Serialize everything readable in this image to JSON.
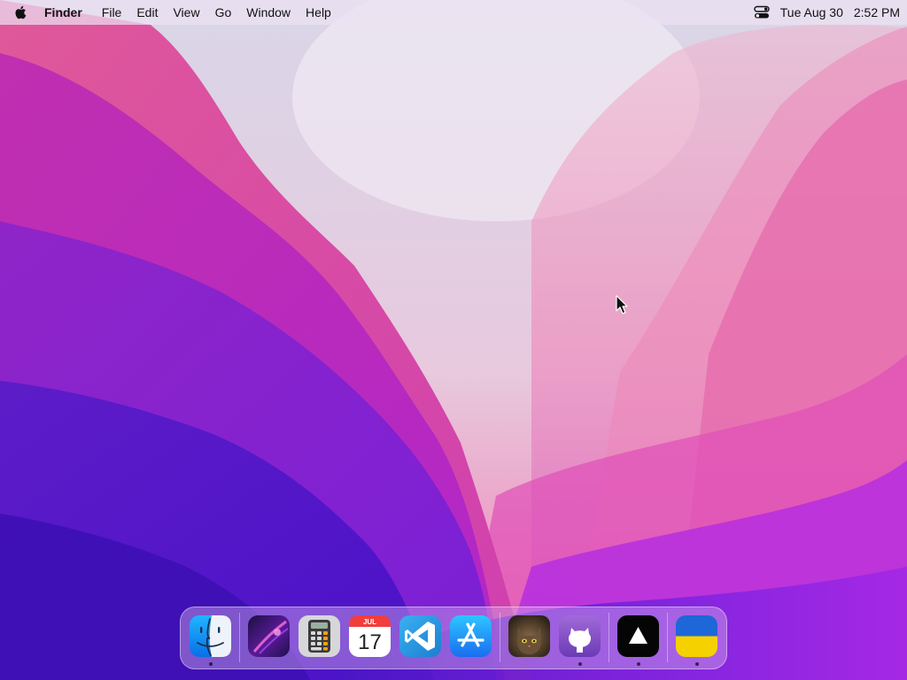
{
  "menubar": {
    "apple_icon": "apple-icon",
    "app_name": "Finder",
    "items": [
      "File",
      "Edit",
      "View",
      "Go",
      "Window",
      "Help"
    ],
    "control_center_icon": "control-center-icon",
    "date": "Tue Aug 30",
    "time": "2:52 PM"
  },
  "dock": {
    "items": [
      {
        "app": "Finder",
        "icon": "finder-icon",
        "running": true
      },
      {
        "app": "Launchpad",
        "icon": "launchpad-icon",
        "running": false
      },
      {
        "app": "Calculator",
        "icon": "calculator-icon",
        "running": false
      },
      {
        "app": "Calendar",
        "icon": "calendar-icon",
        "running": false,
        "month": "JUL",
        "day": "17"
      },
      {
        "app": "Visual Studio Code",
        "icon": "vscode-icon",
        "running": false
      },
      {
        "app": "App Store",
        "icon": "app-store-icon",
        "running": false
      },
      {
        "app": "Cat Photo",
        "icon": "cat-photo-icon",
        "running": false
      },
      {
        "app": "GitHub Desktop",
        "icon": "github-icon",
        "running": true
      },
      {
        "app": "Vercel",
        "icon": "vercel-triangle-icon",
        "running": true
      },
      {
        "app": "Ukraine Flag",
        "icon": "ukraine-flag-icon",
        "running": true
      }
    ]
  },
  "colors": {
    "wallpaper_top_left": "#d8508f",
    "wallpaper_bottom": "#5a12d6",
    "wallpaper_center_light": "#e6dcee",
    "flag_blue": "#1e67d8",
    "flag_yellow": "#f5d100"
  }
}
